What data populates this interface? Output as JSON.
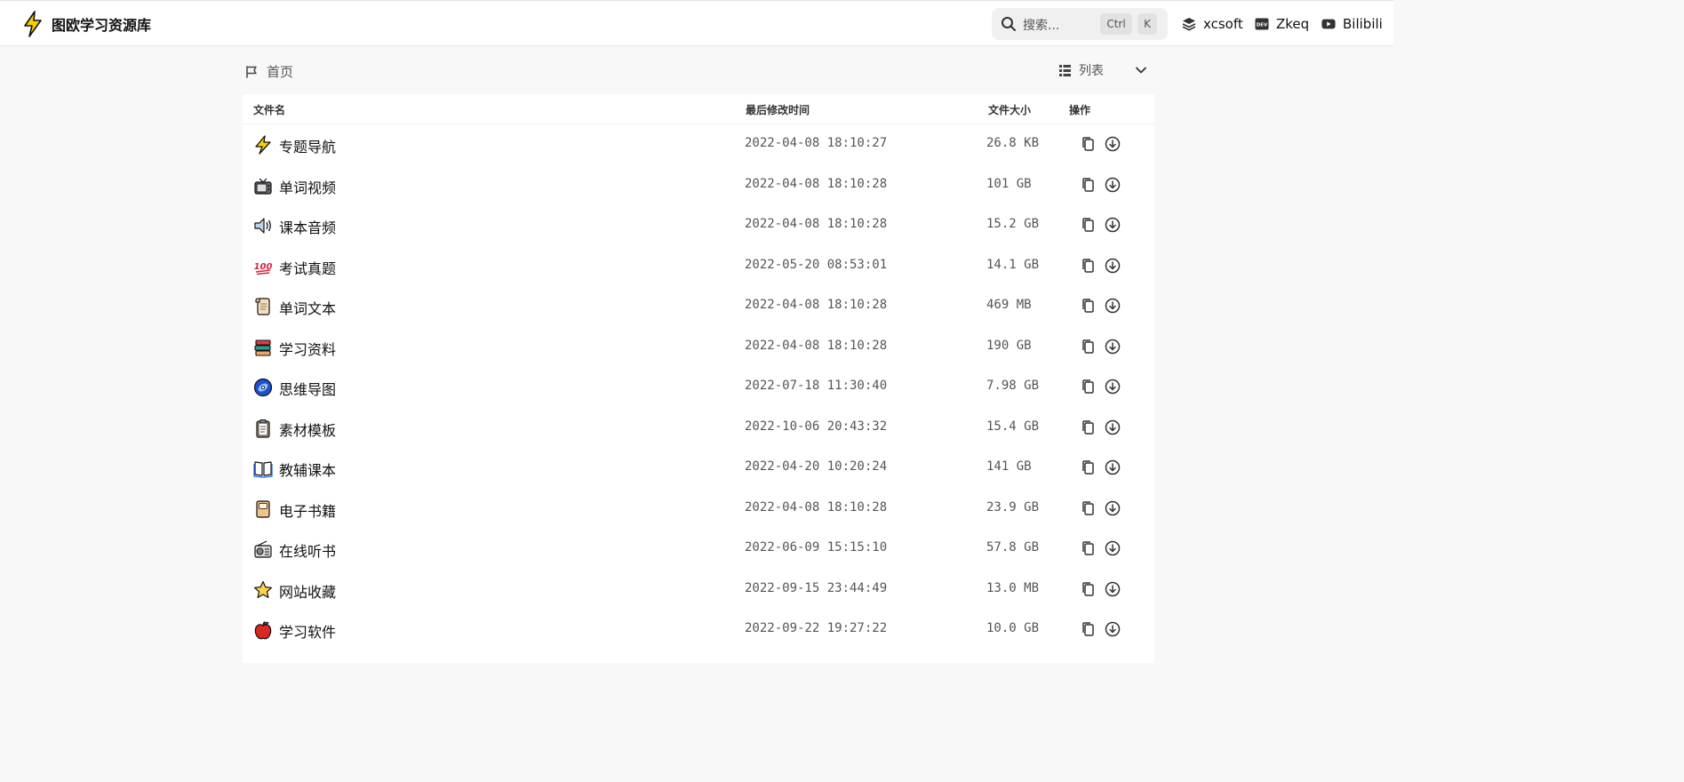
{
  "header": {
    "site_title": "图欧学习资源库",
    "logo_icon": "lightning-bolt-icon",
    "search": {
      "placeholder": "搜索...",
      "key_ctrl": "Ctrl",
      "key_k": "K"
    },
    "links": [
      {
        "label": "xcsoft",
        "icon": "layers-icon"
      },
      {
        "label": "Zkeq",
        "icon": "dev-icon"
      },
      {
        "label": "Bilibili",
        "icon": "youtube-play-icon"
      }
    ]
  },
  "breadcrumb": {
    "home_label": "首页"
  },
  "view": {
    "mode_label": "列表"
  },
  "table": {
    "headers": {
      "name": "文件名",
      "modified": "最后修改时间",
      "size": "文件大小",
      "actions": "操作"
    },
    "rows": [
      {
        "name": "专题导航",
        "modified": "2022-04-08 18:10:27",
        "size": "26.8 KB",
        "icon": "lightning-icon"
      },
      {
        "name": "单词视频",
        "modified": "2022-04-08 18:10:28",
        "size": "101 GB",
        "icon": "tv-icon"
      },
      {
        "name": "课本音频",
        "modified": "2022-04-08 18:10:28",
        "size": "15.2 GB",
        "icon": "speaker-icon"
      },
      {
        "name": "考试真题",
        "modified": "2022-05-20 08:53:01",
        "size": "14.1 GB",
        "icon": "hundred-points-icon"
      },
      {
        "name": "单词文本",
        "modified": "2022-04-08 18:10:28",
        "size": "469 MB",
        "icon": "scroll-icon"
      },
      {
        "name": "学习资料",
        "modified": "2022-04-08 18:10:28",
        "size": "190 GB",
        "icon": "books-icon"
      },
      {
        "name": "思维导图",
        "modified": "2022-07-18 11:30:40",
        "size": "7.98 GB",
        "icon": "disc-icon"
      },
      {
        "name": "素材模板",
        "modified": "2022-10-06 20:43:32",
        "size": "15.4 GB",
        "icon": "clipboard-icon"
      },
      {
        "name": "教辅课本",
        "modified": "2022-04-20 10:20:24",
        "size": "141 GB",
        "icon": "open-book-icon"
      },
      {
        "name": "电子书籍",
        "modified": "2022-04-08 18:10:28",
        "size": "23.9 GB",
        "icon": "notebook-icon"
      },
      {
        "name": "在线听书",
        "modified": "2022-06-09 15:15:10",
        "size": "57.8 GB",
        "icon": "radio-icon"
      },
      {
        "name": "网站收藏",
        "modified": "2022-09-15 23:44:49",
        "size": "13.0 MB",
        "icon": "star-icon"
      },
      {
        "name": "学习软件",
        "modified": "2022-09-22 19:27:22",
        "size": "10.0 GB",
        "icon": "apple-icon"
      }
    ]
  }
}
